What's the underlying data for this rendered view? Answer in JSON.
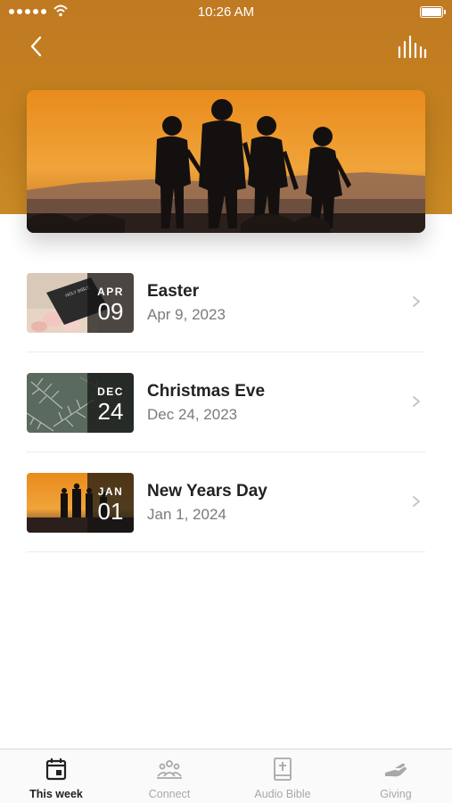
{
  "status_bar": {
    "time": "10:26 AM"
  },
  "header": {
    "back_icon": "chevron-left-icon",
    "audio_icon": "audio-bars-icon",
    "accent_color": "#c4801f"
  },
  "events": [
    {
      "title": "Easter",
      "date": "Apr 9, 2023",
      "badge_month": "APR",
      "badge_day": "09",
      "thumb_theme": "bible-flowers"
    },
    {
      "title": "Christmas Eve",
      "date": "Dec 24, 2023",
      "badge_month": "DEC",
      "badge_day": "24",
      "thumb_theme": "pine-branches"
    },
    {
      "title": "New Years Day",
      "date": "Jan 1, 2024",
      "badge_month": "JAN",
      "badge_day": "01",
      "thumb_theme": "sunset-family"
    }
  ],
  "tabs": [
    {
      "label": "This week",
      "icon": "calendar-icon",
      "active": true
    },
    {
      "label": "Connect",
      "icon": "people-icon",
      "active": false
    },
    {
      "label": "Audio Bible",
      "icon": "bible-icon",
      "active": false
    },
    {
      "label": "Giving",
      "icon": "giving-hand-icon",
      "active": false
    }
  ]
}
